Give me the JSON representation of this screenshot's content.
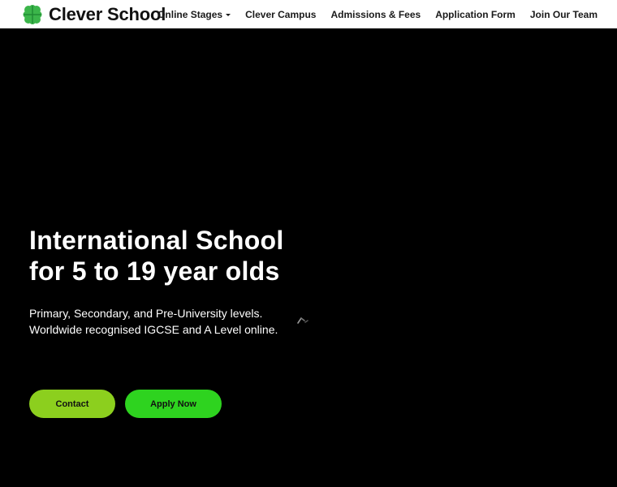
{
  "header": {
    "logo_text": "Clever School",
    "logo_color": "#3bb54a",
    "nav": [
      {
        "label": "Online Stages",
        "has_dropdown": true
      },
      {
        "label": "Clever Campus",
        "has_dropdown": false
      },
      {
        "label": "Admissions & Fees",
        "has_dropdown": false
      },
      {
        "label": "Application Form",
        "has_dropdown": false
      },
      {
        "label": "Join Our Team",
        "has_dropdown": false
      }
    ]
  },
  "hero": {
    "title_line1": "International School",
    "title_line2": "for 5 to 19 year olds",
    "sub_line1": "Primary, Secondary, and Pre-University levels.",
    "sub_line2": "Worldwide recognised IGCSE and A Level online.",
    "spinner_icon": "loading-spinner-icon",
    "contact_label": "Contact",
    "contact_color": "#8ccf1e",
    "apply_label": "Apply Now",
    "apply_color": "#2ed31f"
  }
}
